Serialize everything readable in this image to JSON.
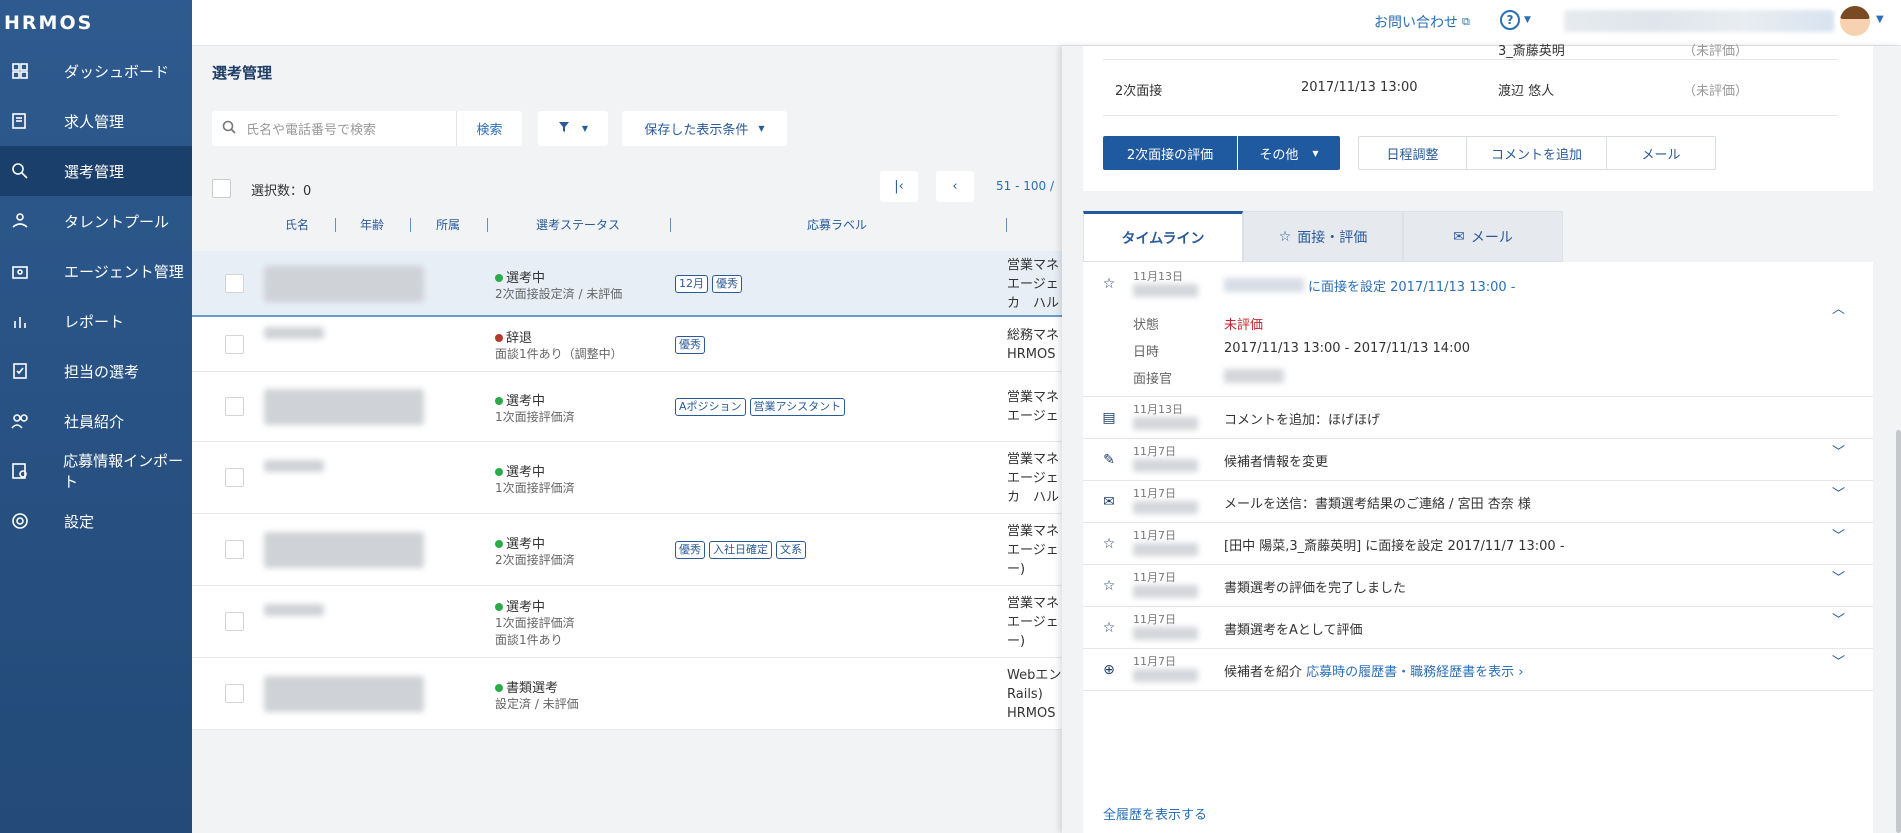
{
  "app": {
    "logo": "HRMOS"
  },
  "sidebar": {
    "items": [
      {
        "label": "ダッシュボード",
        "icon": "dashboard-icon"
      },
      {
        "label": "求人管理",
        "icon": "job-icon"
      },
      {
        "label": "選考管理",
        "icon": "search-person-icon",
        "active": true
      },
      {
        "label": "タレントプール",
        "icon": "talent-pool-icon"
      },
      {
        "label": "エージェント管理",
        "icon": "agent-icon"
      },
      {
        "label": "レポート",
        "icon": "report-icon"
      },
      {
        "label": "担当の選考",
        "icon": "assigned-icon"
      },
      {
        "label": "社員紹介",
        "icon": "referral-icon"
      },
      {
        "label": "応募情報インポート",
        "icon": "import-icon"
      },
      {
        "label": "設定",
        "icon": "gear-icon"
      }
    ]
  },
  "header": {
    "contact": "お問い合わせ",
    "help": "?"
  },
  "main": {
    "title": "選考管理",
    "search_placeholder": "氏名や電話番号で検索",
    "search_button": "検索",
    "saved_conditions": "保存した表示条件",
    "selected_count": "選択数：0",
    "page_range": "51 - 100 /",
    "columns": [
      "氏名",
      "年齢",
      "所属",
      "選考ステータス",
      "応募ラベル"
    ],
    "rows": [
      {
        "status": "選考中",
        "status_color": "#2eaa4a",
        "sub1": "2次面接設定済 / 未評価",
        "sub2": "",
        "labels": [
          "12月",
          "優秀"
        ],
        "pos1": "営業マネ",
        "pos2": "エージェ",
        "pos3": "カ　ハル"
      },
      {
        "status": "辞退",
        "status_color": "#b3392f",
        "sub1": "面談1件あり（調整中）",
        "sub2": "",
        "labels": [
          "優秀"
        ],
        "pos1": "総務マネ",
        "pos2": "HRMOS",
        "pos3": ""
      },
      {
        "status": "選考中",
        "status_color": "#2eaa4a",
        "sub1": "1次面接評価済",
        "sub2": "",
        "labels": [
          "Aポジション",
          "営業アシスタント"
        ],
        "pos1": "営業マネ",
        "pos2": "エージェ",
        "pos3": ""
      },
      {
        "status": "選考中",
        "status_color": "#2eaa4a",
        "sub1": "1次面接評価済",
        "sub2": "",
        "labels": [],
        "pos1": "営業マネ",
        "pos2": "エージェ",
        "pos3": "カ　ハル"
      },
      {
        "status": "選考中",
        "status_color": "#2eaa4a",
        "sub1": "2次面接評価済",
        "sub2": "",
        "labels": [
          "優秀",
          "入社日確定",
          "文系"
        ],
        "pos1": "営業マネ",
        "pos2": "エージェ",
        "pos3": "ー)"
      },
      {
        "status": "選考中",
        "status_color": "#2eaa4a",
        "sub1": "1次面接評価済",
        "sub2": "面談1件あり",
        "labels": [],
        "pos1": "営業マネ",
        "pos2": "エージェ",
        "pos3": "ー)"
      },
      {
        "status": "書類選考",
        "status_color": "#2eaa4a",
        "sub1": "設定済 / 未評価",
        "sub2": "",
        "labels": [],
        "pos1": "Webエン",
        "pos2": "Rails)",
        "pos3": "HRMOS"
      }
    ]
  },
  "panel": {
    "interviews": [
      {
        "stage": "",
        "datetime": "",
        "interviewer": "3_斎藤英明",
        "eval": "（未評価）"
      },
      {
        "stage": "2次面接",
        "datetime": "2017/11/13 13:00",
        "interviewer": "渡辺 悠人",
        "eval": "（未評価）"
      }
    ],
    "buttons": {
      "eval": "2次面接の評価",
      "other": "その他",
      "schedule": "日程調整",
      "comment": "コメントを追加",
      "mail": "メール"
    },
    "tabs": [
      "タイムライン",
      "面接・評価",
      "メール"
    ],
    "timeline": [
      {
        "date": "11月13日",
        "text": "に面接を設定 2017/11/13 13:00 -",
        "icon": "star-icon",
        "details": {
          "status_label": "状態",
          "status_value": "未評価",
          "date_label": "日時",
          "date_value": "2017/11/13 13:00 - 2017/11/13 14:00",
          "interviewer_label": "面接官"
        }
      },
      {
        "date": "11月13日",
        "text": "コメントを追加：ほげほげ",
        "icon": "comment-icon"
      },
      {
        "date": "11月7日",
        "text": "候補者情報を変更",
        "icon": "pencil-icon"
      },
      {
        "date": "11月7日",
        "text": "メールを送信：書類選考結果のご連絡 / 宮田 杏奈 様",
        "icon": "mail-icon"
      },
      {
        "date": "11月7日",
        "text": "[田中 陽菜,3_斎藤英明] に面接を設定 2017/11/7 13:00 -",
        "icon": "star-icon"
      },
      {
        "date": "11月7日",
        "text": "書類選考の評価を完了しました",
        "icon": "star-icon"
      },
      {
        "date": "11月7日",
        "text": "書類選考をAとして評価",
        "icon": "star-icon"
      },
      {
        "date": "11月7日",
        "text": "候補者を紹介",
        "link": "応募時の履歴書・職務経歴書を表示 ›",
        "icon": "plus-circle-icon"
      }
    ],
    "show_all": "全履歴を表示する"
  }
}
